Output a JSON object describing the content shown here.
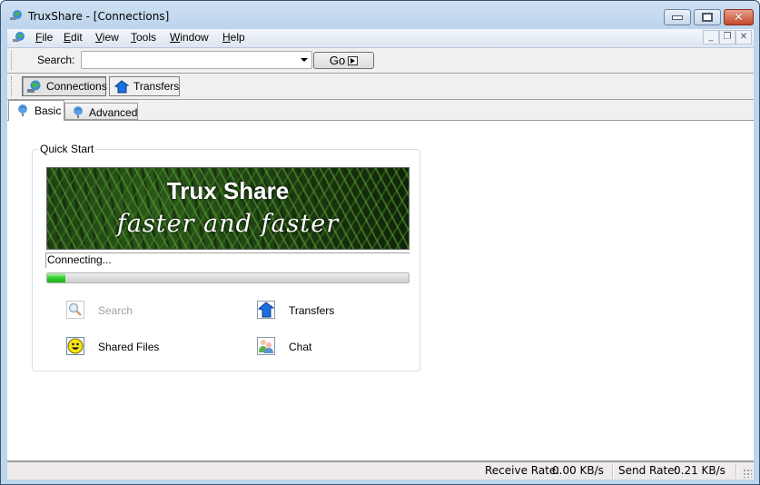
{
  "window": {
    "title": "TruxShare - [Connections]",
    "controls": {
      "minimize": "minimize",
      "maximize": "maximize",
      "close": "close"
    }
  },
  "menubar": {
    "items": [
      {
        "label": "File",
        "accel": "F"
      },
      {
        "label": "Edit",
        "accel": "E"
      },
      {
        "label": "View",
        "accel": "V"
      },
      {
        "label": "Tools",
        "accel": "T"
      },
      {
        "label": "Window",
        "accel": "W"
      },
      {
        "label": "Help",
        "accel": "H"
      }
    ],
    "mdi_controls": {
      "minimize": "_",
      "restore": "❐",
      "close": "✕"
    }
  },
  "search_toolbar": {
    "label": "Search:",
    "value": "",
    "placeholder": "",
    "go_label": "Go"
  },
  "view_toolbar": {
    "buttons": [
      {
        "label": "Connections",
        "icon": "globe-connections-icon",
        "pressed": true
      },
      {
        "label": "Transfers",
        "icon": "transfers-arrow-icon",
        "pressed": false
      }
    ]
  },
  "tabs": [
    {
      "label": "Basic",
      "active": true
    },
    {
      "label": "Advanced",
      "active": false
    }
  ],
  "quick_start": {
    "title": "Quick Start",
    "banner": {
      "title": "Trux Share",
      "subtitle": "faster and faster"
    },
    "status_text": "Connecting...",
    "progress_fraction": 0.05,
    "actions": [
      {
        "label": "Search",
        "icon": "search-magnifier-icon",
        "enabled": false
      },
      {
        "label": "Transfers",
        "icon": "transfers-arrow-icon",
        "enabled": true
      },
      {
        "label": "Shared Files",
        "icon": "smiley-icon",
        "enabled": true
      },
      {
        "label": "Chat",
        "icon": "chat-users-icon",
        "enabled": true
      }
    ]
  },
  "statusbar": {
    "receive_label": "Receive Rate:",
    "receive_value": "0.00 KB/s",
    "send_label": "Send Rate:",
    "send_value": "0.21 KB/s"
  },
  "colors": {
    "progress_green": "#2fcf2a",
    "titlebar_blue": "#bcd4ec",
    "close_red": "#c4482c"
  }
}
